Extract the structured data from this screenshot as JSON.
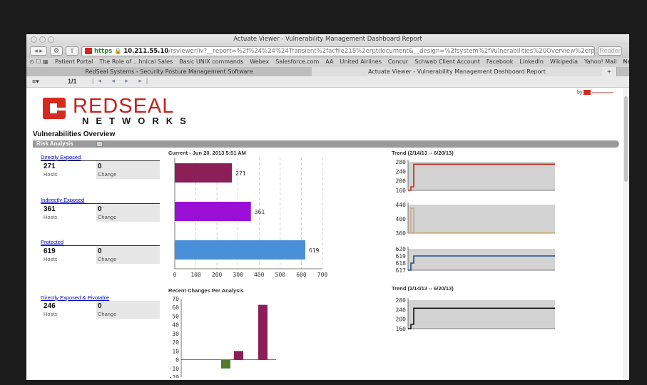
{
  "browser": {
    "window_title": "Actuate Viewer - Vulnerability Management Dashboard Report",
    "url_scheme": "https",
    "url_host": "10.211.55.10",
    "url_path": "/rsviewer/iv?__report=%2f%24%24%24Transient%2facfile218%2erptdocument&__design=%2fsystem%2fVulnerabilities%20Overview%2erptdesign&connectionHandle=",
    "reader_label": "Reader",
    "bookmarks": [
      "Patient Portal",
      "The Role of ...hnical Sales",
      "Basic UNIX commands",
      "Webex",
      "Salesforce.com",
      "AA",
      "United Airlines",
      "Concur",
      "Schwab Client Account",
      "Facebook",
      "LinkedIn",
      "Wikipedia",
      "Yahoo! Mail",
      "News ▾"
    ],
    "bookmarks_more": "»",
    "tabs": [
      {
        "label": "RedSeal Systems - Security Posture Management Software"
      },
      {
        "label": "Actuate Viewer - Vulnerability Management Dashboard Report"
      }
    ],
    "new_tab": "+"
  },
  "viewer": {
    "page_indicator": "1/1"
  },
  "report": {
    "logo_text": "REDSEAL",
    "logo_subtext": "NETWORKS",
    "by_label": "by",
    "section_title": "Vulnerabilities Overview",
    "risk_analysis_label": "Risk Analysis",
    "metrics": [
      {
        "link": "Directly Exposed",
        "value": "271",
        "value_label": "Hosts",
        "change": "0",
        "change_label": "Change"
      },
      {
        "link": "Indirectly Exposed",
        "value": "361",
        "value_label": "Hosts",
        "change": "0",
        "change_label": "Change"
      },
      {
        "link": "Protected",
        "value": "619",
        "value_label": "Hosts",
        "change": "0",
        "change_label": "Change"
      },
      {
        "link": "Directly Exposed & Pivotable",
        "value": "246",
        "value_label": "Hosts",
        "change": "0",
        "change_label": "Change"
      }
    ],
    "current_title": "Current - Jun 20, 2013 5:51 AM",
    "trend_title_1": "Trend (2/14/13 -- 6/20/13)",
    "trend_title_2": "Trend (2/14/13 -- 6/20/13)",
    "recent_title": "Recent Changes Per Analysis"
  },
  "colors": {
    "directly_exposed": "#8b1f58",
    "indirectly_exposed": "#9b10d6",
    "protected": "#4a90d9",
    "trend_red": "#c0281f",
    "trend_tan": "#c8a97a",
    "trend_blue": "#1f4f8a",
    "trend_black": "#111111",
    "change_green": "#4f7a2a"
  },
  "chart_data": [
    {
      "type": "bar",
      "orientation": "horizontal",
      "categories": [
        "Directly Exposed",
        "Indirectly Exposed",
        "Protected"
      ],
      "values": [
        271,
        361,
        619
      ],
      "xlim": [
        0,
        700
      ],
      "xticks": [
        0,
        100,
        200,
        300,
        400,
        500,
        600,
        700
      ],
      "grid": true
    },
    {
      "type": "line",
      "ylim": [
        160,
        280
      ],
      "yticks": [
        280,
        240,
        200,
        160
      ],
      "values": [
        160,
        175,
        175,
        270,
        270,
        270
      ],
      "color": "#c0281f"
    },
    {
      "type": "line",
      "ylim": [
        360,
        440
      ],
      "yticks": [
        440,
        400,
        360
      ],
      "values": [
        360,
        430,
        430,
        361,
        361,
        361
      ],
      "color": "#c8a97a"
    },
    {
      "type": "line",
      "ylim": [
        617,
        620
      ],
      "yticks": [
        620,
        619,
        618,
        617
      ],
      "values": [
        617,
        618,
        618,
        619,
        619,
        619
      ],
      "color": "#1f4f8a"
    },
    {
      "type": "line",
      "ylim": [
        160,
        280
      ],
      "yticks": [
        280,
        240,
        200,
        160
      ],
      "values": [
        160,
        178,
        178,
        246,
        246,
        246
      ],
      "color": "#111111"
    },
    {
      "type": "bar",
      "ylim": [
        -20,
        70
      ],
      "yticks": [
        70,
        60,
        50,
        40,
        30,
        20,
        10,
        0,
        -10,
        -20
      ],
      "values": [
        -10,
        10,
        63
      ],
      "colors": [
        "#4f7a2a",
        "#8b1f58",
        "#8b1f58"
      ]
    }
  ]
}
